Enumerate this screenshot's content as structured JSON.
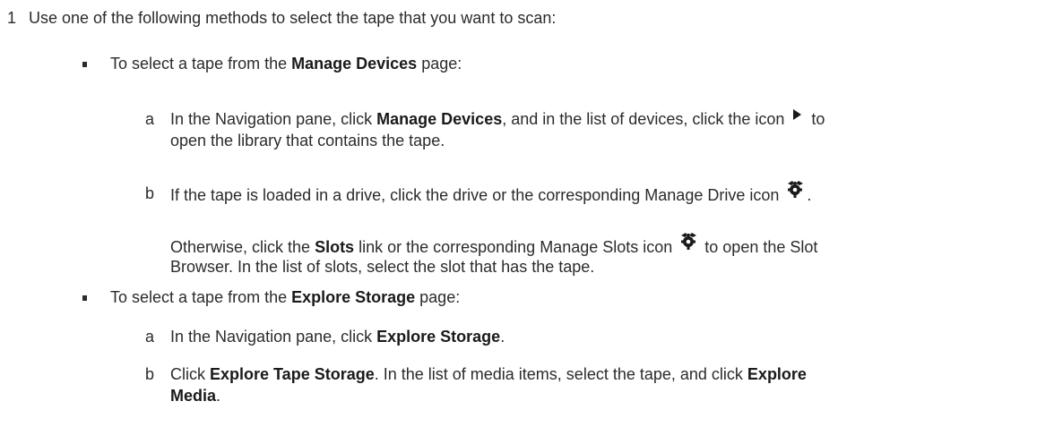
{
  "step1": {
    "number": "1",
    "text": "Use one of the following methods to select the tape that you want to scan:"
  },
  "bullet1": {
    "prefix": "To select a tape from the ",
    "bold": "Manage Devices",
    "suffix": " page:",
    "a": {
      "letter": "a",
      "t1": "In the Navigation pane, click ",
      "b1": "Manage Devices",
      "t2": ", and in the list of devices, click the icon ",
      "t3": " to",
      "line2": "open the library that contains the tape.",
      "icon": "play-triangle-icon"
    },
    "b": {
      "letter": "b",
      "t1": "If the tape is loaded in a drive, click the drive or the corresponding Manage Drive icon ",
      "t2": ".",
      "icon": "manage-gear-icon"
    },
    "otherwise": {
      "t1": "Otherwise, click the ",
      "b1": "Slots",
      "t2": " link or the corresponding Manage Slots icon ",
      "t3": " to open the Slot",
      "line2": "Browser. In the list of slots, select the slot that has the tape.",
      "icon": "manage-gear-icon"
    }
  },
  "bullet2": {
    "prefix": "To select a tape from the ",
    "bold": "Explore Storage",
    "suffix": " page:",
    "a": {
      "letter": "a",
      "t1": "In the Navigation pane, click ",
      "b1": "Explore Storage",
      "t2": "."
    },
    "b": {
      "letter": "b",
      "t1": "Click ",
      "b1": "Explore Tape Storage",
      "t2": ". In the list of media items, select the tape, and click ",
      "b2": "Explore",
      "line2_bold": "Media",
      "line2_rest": "."
    }
  }
}
